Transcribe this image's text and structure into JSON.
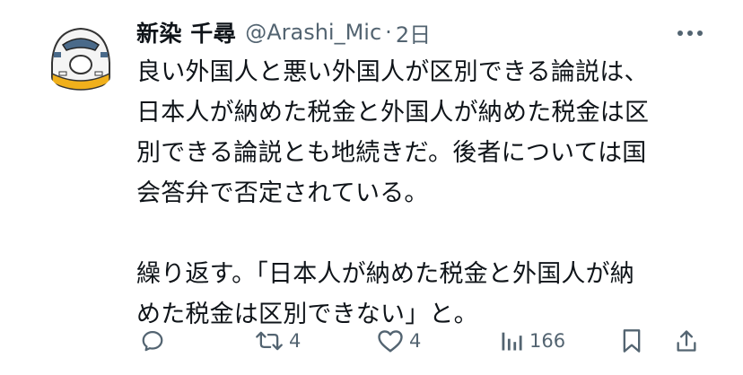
{
  "post": {
    "display_name": "新染 千尋",
    "handle": "@Arashi_Mic",
    "separator": "·",
    "time": "2日",
    "body_lines_1": [
      "良い外国人と悪い外国人が区別できる論説は、",
      "日本人が納めた税金と外国人が納めた税金は区",
      "別できる論説とも地続きだ。後者については国",
      "会答弁で否定されている。"
    ],
    "body_lines_2": [
      "繰り返す。「日本人が納めた税金と外国人が納",
      "めた税金は区別できない」と。"
    ]
  },
  "actions": {
    "replies": "",
    "reposts": "4",
    "likes": "4",
    "views": "166"
  },
  "icons": {
    "avatar": "bullet-train-avatar",
    "more": "more-dots-icon",
    "reply": "reply-icon",
    "repost": "repost-icon",
    "like": "heart-icon",
    "views": "views-bar-chart-icon",
    "bookmark": "bookmark-icon",
    "share": "share-icon"
  },
  "colors": {
    "text": "#0f1419",
    "muted": "#536471",
    "avatar_accent": "#f0b01c"
  }
}
